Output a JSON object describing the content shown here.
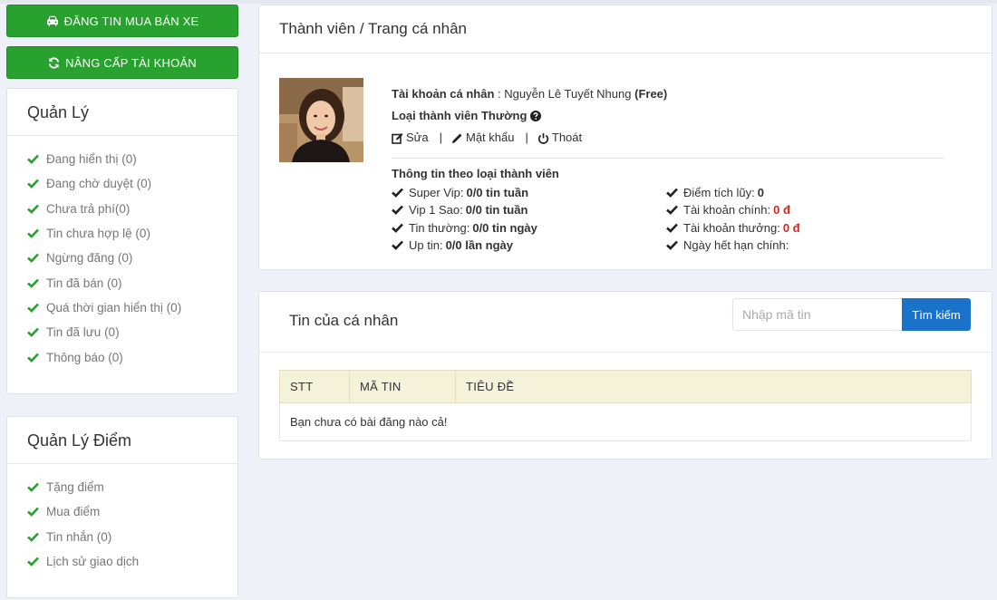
{
  "sidebar": {
    "post_button": "ĐĂNG TIN MUA BÁN XE",
    "upgrade_button": "NÂNG CẤP TÀI KHOẢN",
    "manage": {
      "title": "Quản Lý",
      "items": [
        "Đang hiển thị (0)",
        "Đang chờ duyệt (0)",
        "Chưa trả phí(0)",
        "Tin chưa hợp lệ (0)",
        "Ngừng đăng (0)",
        "Tin đã bán (0)",
        "Quá thời gian hiển thị (0)",
        "Tin đã lưu (0)",
        "Thông báo (0)"
      ]
    },
    "points": {
      "title": "Quản Lý Điểm",
      "items": [
        "Tặng điểm",
        "Mua điểm",
        "Tin nhắn (0)",
        "Lịch sử giao dịch"
      ]
    }
  },
  "profile": {
    "breadcrumb": "Thành viên / Trang cá nhân",
    "account_label": "Tài khoản cá nhân",
    "account_sep": " : ",
    "name": "Nguyễn Lê Tuyết Nhung",
    "plan": "(Free)",
    "member_type_label": "Loại thành viên",
    "member_type": "Thường",
    "actions": {
      "edit": "Sửa",
      "password": "Mật khẩu",
      "logout": "Thoát",
      "separator": "|"
    },
    "member_info_title": "Thông tin theo loại thành viên",
    "left_stats": [
      {
        "label": "Super Vip:",
        "value": "0/0 tin tuần"
      },
      {
        "label": "Vip 1 Sao:",
        "value": "0/0 tin tuần"
      },
      {
        "label": "Tin thường:",
        "value": "0/0 tin ngày"
      },
      {
        "label": "Up tin:",
        "value": "0/0 lần ngày"
      }
    ],
    "right_stats": [
      {
        "label": "Điểm tích lũy:",
        "value": "0"
      },
      {
        "label": "Tài khoản chính:",
        "value": "0 đ"
      },
      {
        "label": "Tài khoản thưởng:",
        "value": "0 đ"
      },
      {
        "label": "Ngày hết hạn chính:",
        "value": ""
      }
    ],
    "colors": {
      "accent_red": "#d9261c",
      "green": "#28a12e",
      "blue": "#1a73c9"
    }
  },
  "posts": {
    "title": "Tin của cá nhân",
    "search_placeholder": "Nhập mã tin",
    "search_button": "Tìm kiếm",
    "columns": [
      "STT",
      "MÃ TIN",
      "TIÊU ĐỀ"
    ],
    "empty_message": "Bạn chưa có bài đăng nào cả!"
  }
}
